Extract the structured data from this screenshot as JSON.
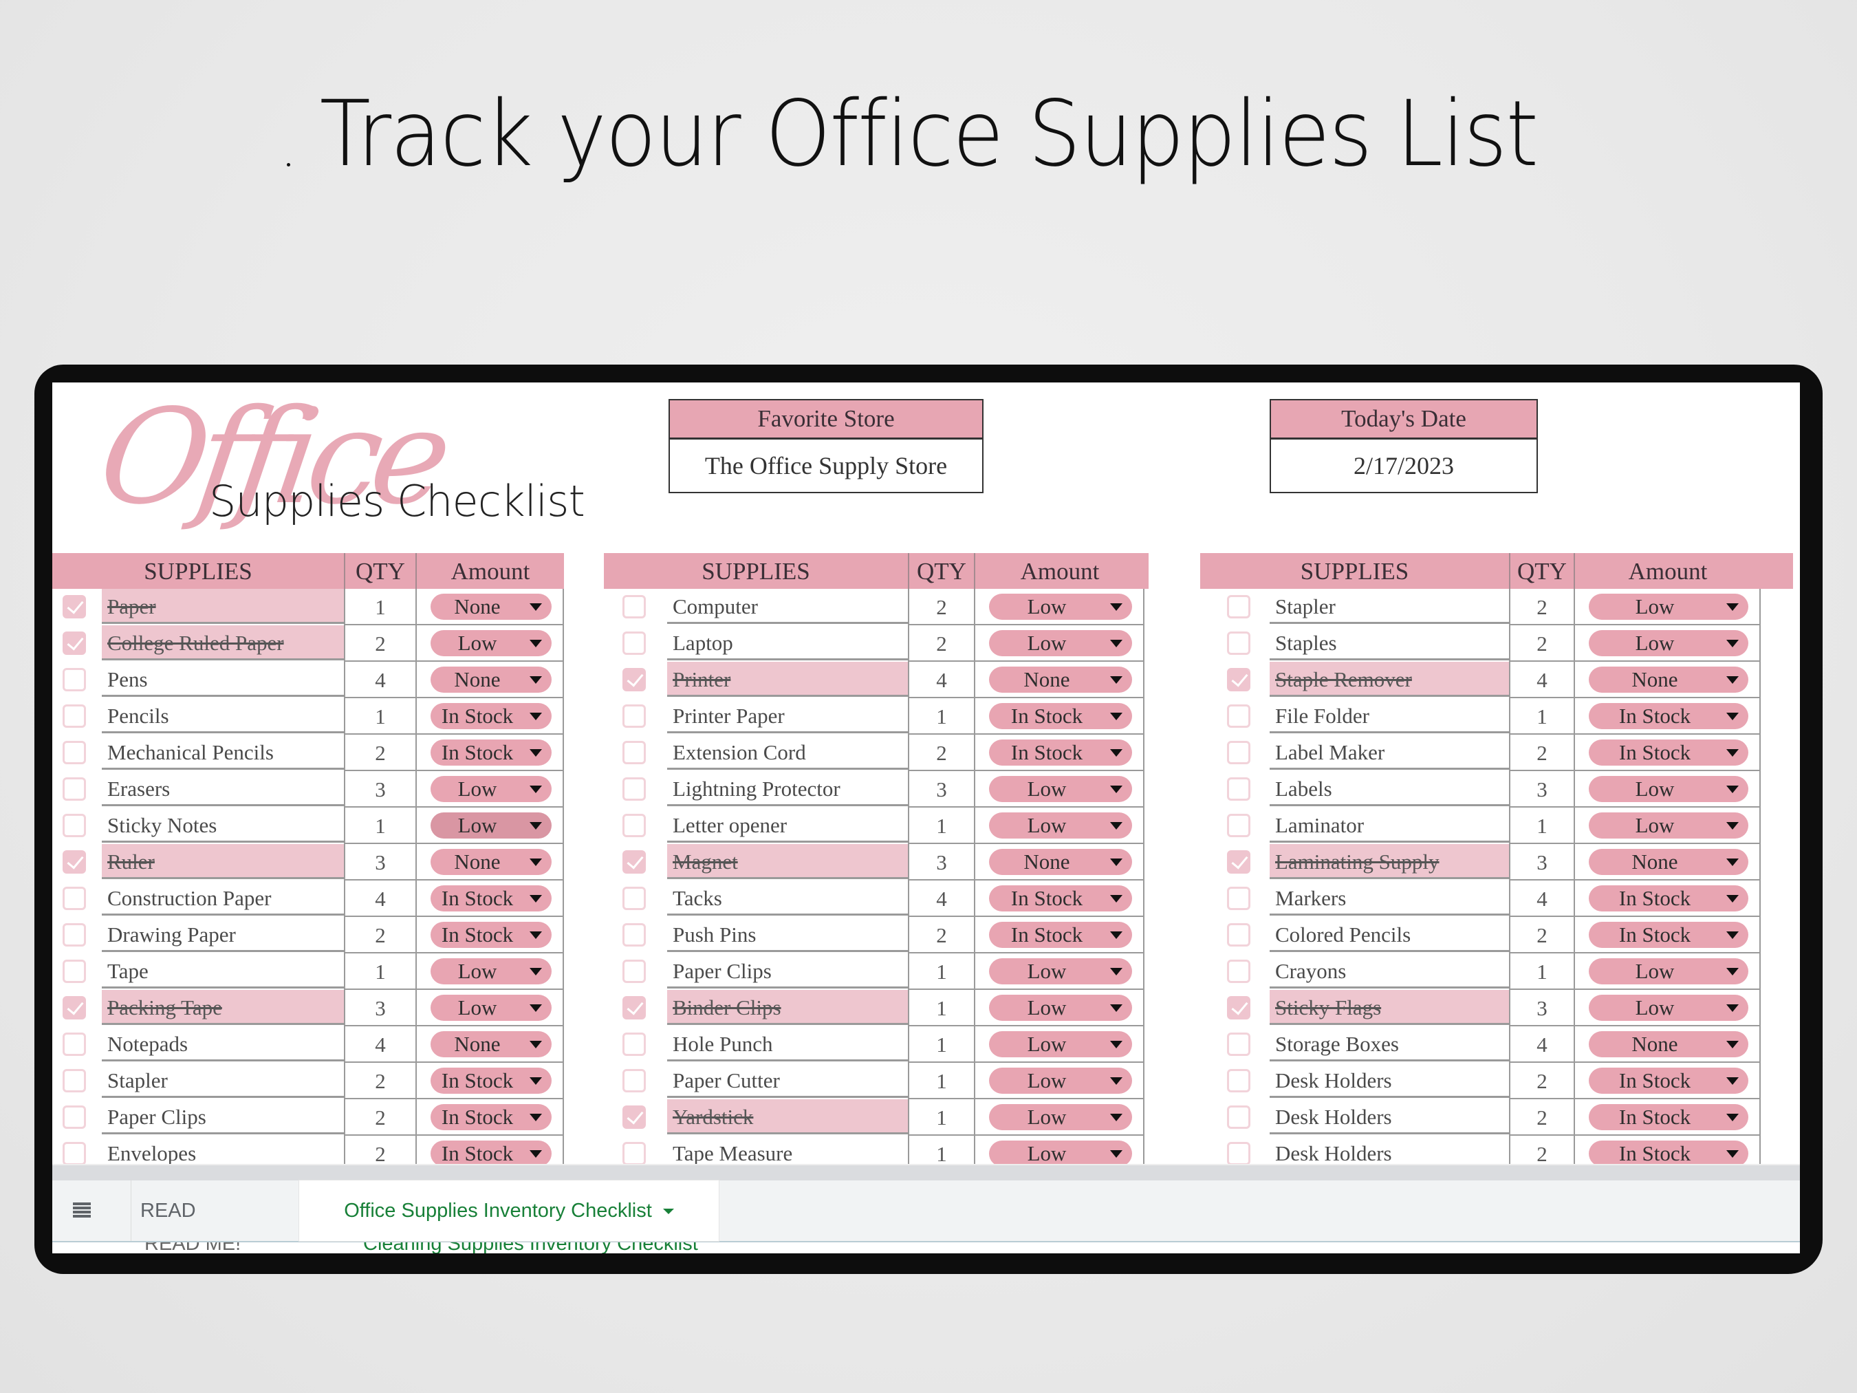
{
  "headline": "Track your Office Supplies List",
  "logo": {
    "script": "Office",
    "subtitle": "Supplies Checklist"
  },
  "favorite_store": {
    "label": "Favorite Store",
    "value": "The Office Supply Store"
  },
  "todays_date": {
    "label": "Today's Date",
    "value": "2/17/2023"
  },
  "columns": {
    "supplies": "SUPPLIES",
    "qty": "QTY",
    "amount": "Amount"
  },
  "amount_options_seen": [
    "None",
    "Low",
    "In Stock"
  ],
  "colors": {
    "header_pink": "#e7a6b3",
    "checked_row": "#eec6cf",
    "pill": "#e8a5b2",
    "pill_hover": "#d996a3",
    "active_tab": "#188038"
  },
  "tables": [
    {
      "rows": [
        {
          "done": true,
          "name": "Paper",
          "qty": "1",
          "amount": "None"
        },
        {
          "done": true,
          "name": "College Ruled Paper",
          "qty": "2",
          "amount": "Low"
        },
        {
          "done": false,
          "name": "Pens",
          "qty": "4",
          "amount": "None"
        },
        {
          "done": false,
          "name": "Pencils",
          "qty": "1",
          "amount": "In Stock"
        },
        {
          "done": false,
          "name": "Mechanical Pencils",
          "qty": "2",
          "amount": "In Stock"
        },
        {
          "done": false,
          "name": "Erasers",
          "qty": "3",
          "amount": "Low"
        },
        {
          "done": false,
          "name": "Sticky Notes",
          "qty": "1",
          "amount": "Low",
          "hover": true
        },
        {
          "done": true,
          "name": "Ruler",
          "qty": "3",
          "amount": "None"
        },
        {
          "done": false,
          "name": "Construction Paper",
          "qty": "4",
          "amount": "In Stock"
        },
        {
          "done": false,
          "name": "Drawing Paper",
          "qty": "2",
          "amount": "In Stock"
        },
        {
          "done": false,
          "name": "Tape",
          "qty": "1",
          "amount": "Low"
        },
        {
          "done": true,
          "name": "Packing Tape",
          "qty": "3",
          "amount": "Low"
        },
        {
          "done": false,
          "name": "Notepads",
          "qty": "4",
          "amount": "None"
        },
        {
          "done": false,
          "name": "Stapler",
          "qty": "2",
          "amount": "In Stock"
        },
        {
          "done": false,
          "name": "Paper Clips",
          "qty": "2",
          "amount": "In Stock"
        },
        {
          "done": false,
          "name": "Envelopes",
          "qty": "2",
          "amount": "In Stock"
        }
      ]
    },
    {
      "rows": [
        {
          "done": false,
          "name": "Computer",
          "qty": "2",
          "amount": "Low"
        },
        {
          "done": false,
          "name": "Laptop",
          "qty": "2",
          "amount": "Low"
        },
        {
          "done": true,
          "name": "Printer",
          "qty": "4",
          "amount": "None"
        },
        {
          "done": false,
          "name": "Printer Paper",
          "qty": "1",
          "amount": "In Stock"
        },
        {
          "done": false,
          "name": "Extension Cord",
          "qty": "2",
          "amount": "In Stock"
        },
        {
          "done": false,
          "name": "Lightning Protector",
          "qty": "3",
          "amount": "Low"
        },
        {
          "done": false,
          "name": "Letter opener",
          "qty": "1",
          "amount": "Low"
        },
        {
          "done": true,
          "name": "Magnet",
          "qty": "3",
          "amount": "None"
        },
        {
          "done": false,
          "name": "Tacks",
          "qty": "4",
          "amount": "In Stock"
        },
        {
          "done": false,
          "name": "Push Pins",
          "qty": "2",
          "amount": "In Stock"
        },
        {
          "done": false,
          "name": "Paper Clips",
          "qty": "1",
          "amount": "Low"
        },
        {
          "done": true,
          "name": "Binder Clips",
          "qty": "1",
          "amount": "Low"
        },
        {
          "done": false,
          "name": "Hole Punch",
          "qty": "1",
          "amount": "Low"
        },
        {
          "done": false,
          "name": "Paper Cutter",
          "qty": "1",
          "amount": "Low"
        },
        {
          "done": true,
          "name": "Yardstick",
          "qty": "1",
          "amount": "Low"
        },
        {
          "done": false,
          "name": "Tape Measure",
          "qty": "1",
          "amount": "Low"
        }
      ]
    },
    {
      "rows": [
        {
          "done": false,
          "name": "Stapler",
          "qty": "2",
          "amount": "Low"
        },
        {
          "done": false,
          "name": "Staples",
          "qty": "2",
          "amount": "Low"
        },
        {
          "done": true,
          "name": "Staple Remover",
          "qty": "4",
          "amount": "None"
        },
        {
          "done": false,
          "name": "File Folder",
          "qty": "1",
          "amount": "In Stock"
        },
        {
          "done": false,
          "name": "Label Maker",
          "qty": "2",
          "amount": "In Stock"
        },
        {
          "done": false,
          "name": "Labels",
          "qty": "3",
          "amount": "Low"
        },
        {
          "done": false,
          "name": "Laminator",
          "qty": "1",
          "amount": "Low"
        },
        {
          "done": true,
          "name": "Laminating Supply",
          "qty": "3",
          "amount": "None"
        },
        {
          "done": false,
          "name": "Markers",
          "qty": "4",
          "amount": "In Stock"
        },
        {
          "done": false,
          "name": "Colored Pencils",
          "qty": "2",
          "amount": "In Stock"
        },
        {
          "done": false,
          "name": "Crayons",
          "qty": "1",
          "amount": "Low"
        },
        {
          "done": true,
          "name": "Sticky Flags",
          "qty": "3",
          "amount": "Low"
        },
        {
          "done": false,
          "name": "Storage Boxes",
          "qty": "4",
          "amount": "None"
        },
        {
          "done": false,
          "name": "Desk Holders",
          "qty": "2",
          "amount": "In Stock"
        },
        {
          "done": false,
          "name": "Desk Holders",
          "qty": "2",
          "amount": "In Stock"
        },
        {
          "done": false,
          "name": "Desk Holders",
          "qty": "2",
          "amount": "In Stock"
        }
      ]
    }
  ],
  "sheet_tabs": {
    "menu_icon": "all-sheets-icon",
    "readme": "READ ME!",
    "active": "Office Supplies Inventory Checklist",
    "ghost_readme": "READ ME!",
    "ghost_tab": "Cleaning Supplies Inventory Checklist"
  }
}
